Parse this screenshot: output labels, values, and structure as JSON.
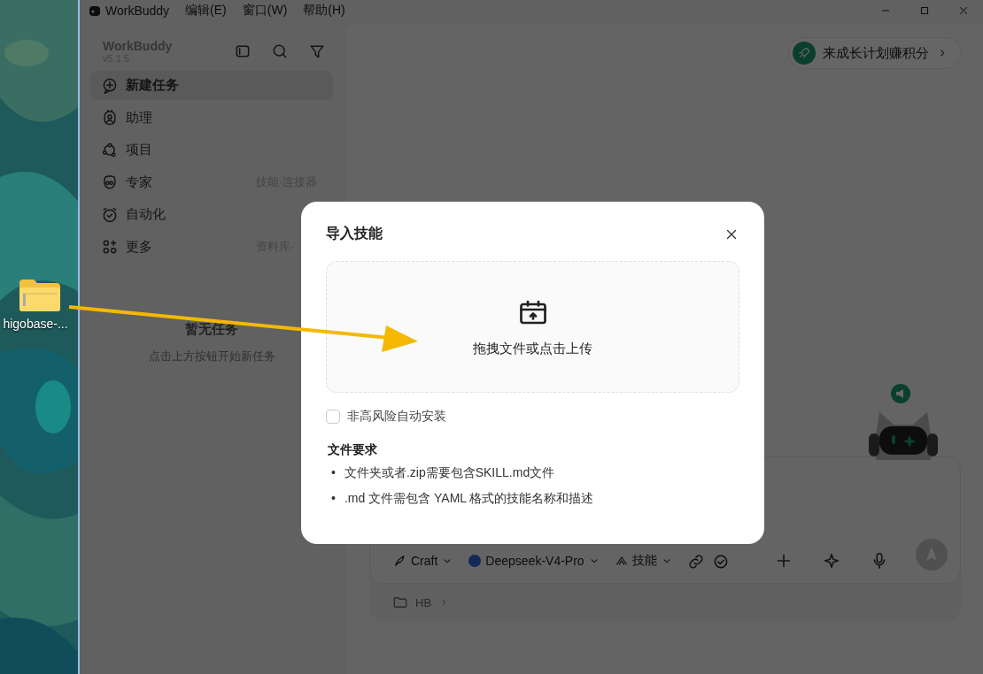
{
  "desktop": {
    "files": [
      {
        "label": "higobase-..."
      }
    ]
  },
  "window": {
    "title": "WorkBuddy",
    "menu": [
      "编辑(E)",
      "窗口(W)",
      "帮助(H)"
    ]
  },
  "sidebar": {
    "title": "WorkBuddy",
    "version": "v5.1.5",
    "items": [
      {
        "label": "新建任务",
        "selected": true
      },
      {
        "label": "助理",
        "selected": false
      },
      {
        "label": "项目",
        "selected": false
      },
      {
        "label": "专家",
        "hint": "技能·连接器",
        "selected": false
      },
      {
        "label": "自动化",
        "selected": false
      },
      {
        "label": "更多",
        "hint": "资料库·",
        "selected": false
      }
    ],
    "empty_title": "暂无任务",
    "empty_hint": "点击上方按钮开始新任务"
  },
  "main": {
    "promo": "来成长计划赚积分",
    "composer": {
      "mode": "Craft",
      "model": "Deepseek-V4-Pro",
      "skills": "技能",
      "folder": "HB"
    }
  },
  "dialog": {
    "title": "导入技能",
    "upload_text": "拖拽文件或点击上传",
    "auto_install": {
      "label": "非高风险自动安装",
      "checked": false
    },
    "requirements_title": "文件要求",
    "requirements": [
      {
        "bullet": "•",
        "text": "文件夹或者.zip需要包含SKILL.md文件"
      },
      {
        "bullet": "•",
        "text": ".md 文件需包含 YAML 格式的技能名称和描述"
      }
    ]
  }
}
